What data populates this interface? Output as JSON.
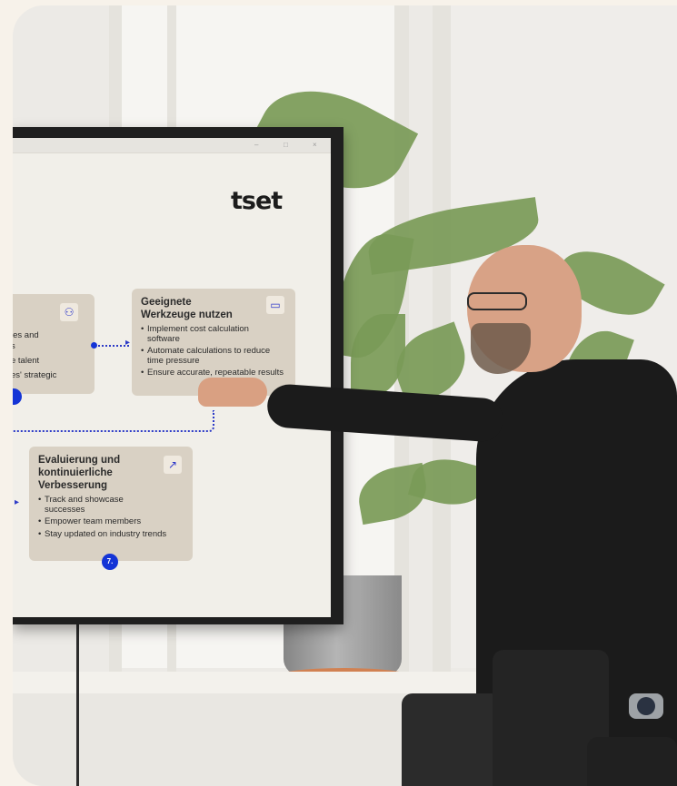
{
  "slide": {
    "logo": "tset",
    "card_left_partial": {
      "lines": [
        "les and",
        "s",
        "e talent",
        "es' strategic"
      ]
    },
    "card_tools": {
      "title_line1": "Geeignete",
      "title_line2": "Werkzeuge nutzen",
      "bullets": [
        "Implement cost calculation software",
        "Automate calculations to reduce time pressure",
        "Ensure accurate, repeatable results"
      ]
    },
    "card_eval": {
      "title_line1": "Evaluierung und",
      "title_line2": "kontinuierliche",
      "title_line3": "Verbesserung",
      "bullets": [
        "Track and showcase successes",
        "Empower team members",
        "Stay updated on industry trends"
      ],
      "badge": "7."
    }
  },
  "colors": {
    "accent": "#1434d6",
    "card": "#d9d1c4",
    "background": "#f7f2ea"
  },
  "icons": [
    "users-icon",
    "monitor-icon",
    "trend-chart-icon"
  ]
}
